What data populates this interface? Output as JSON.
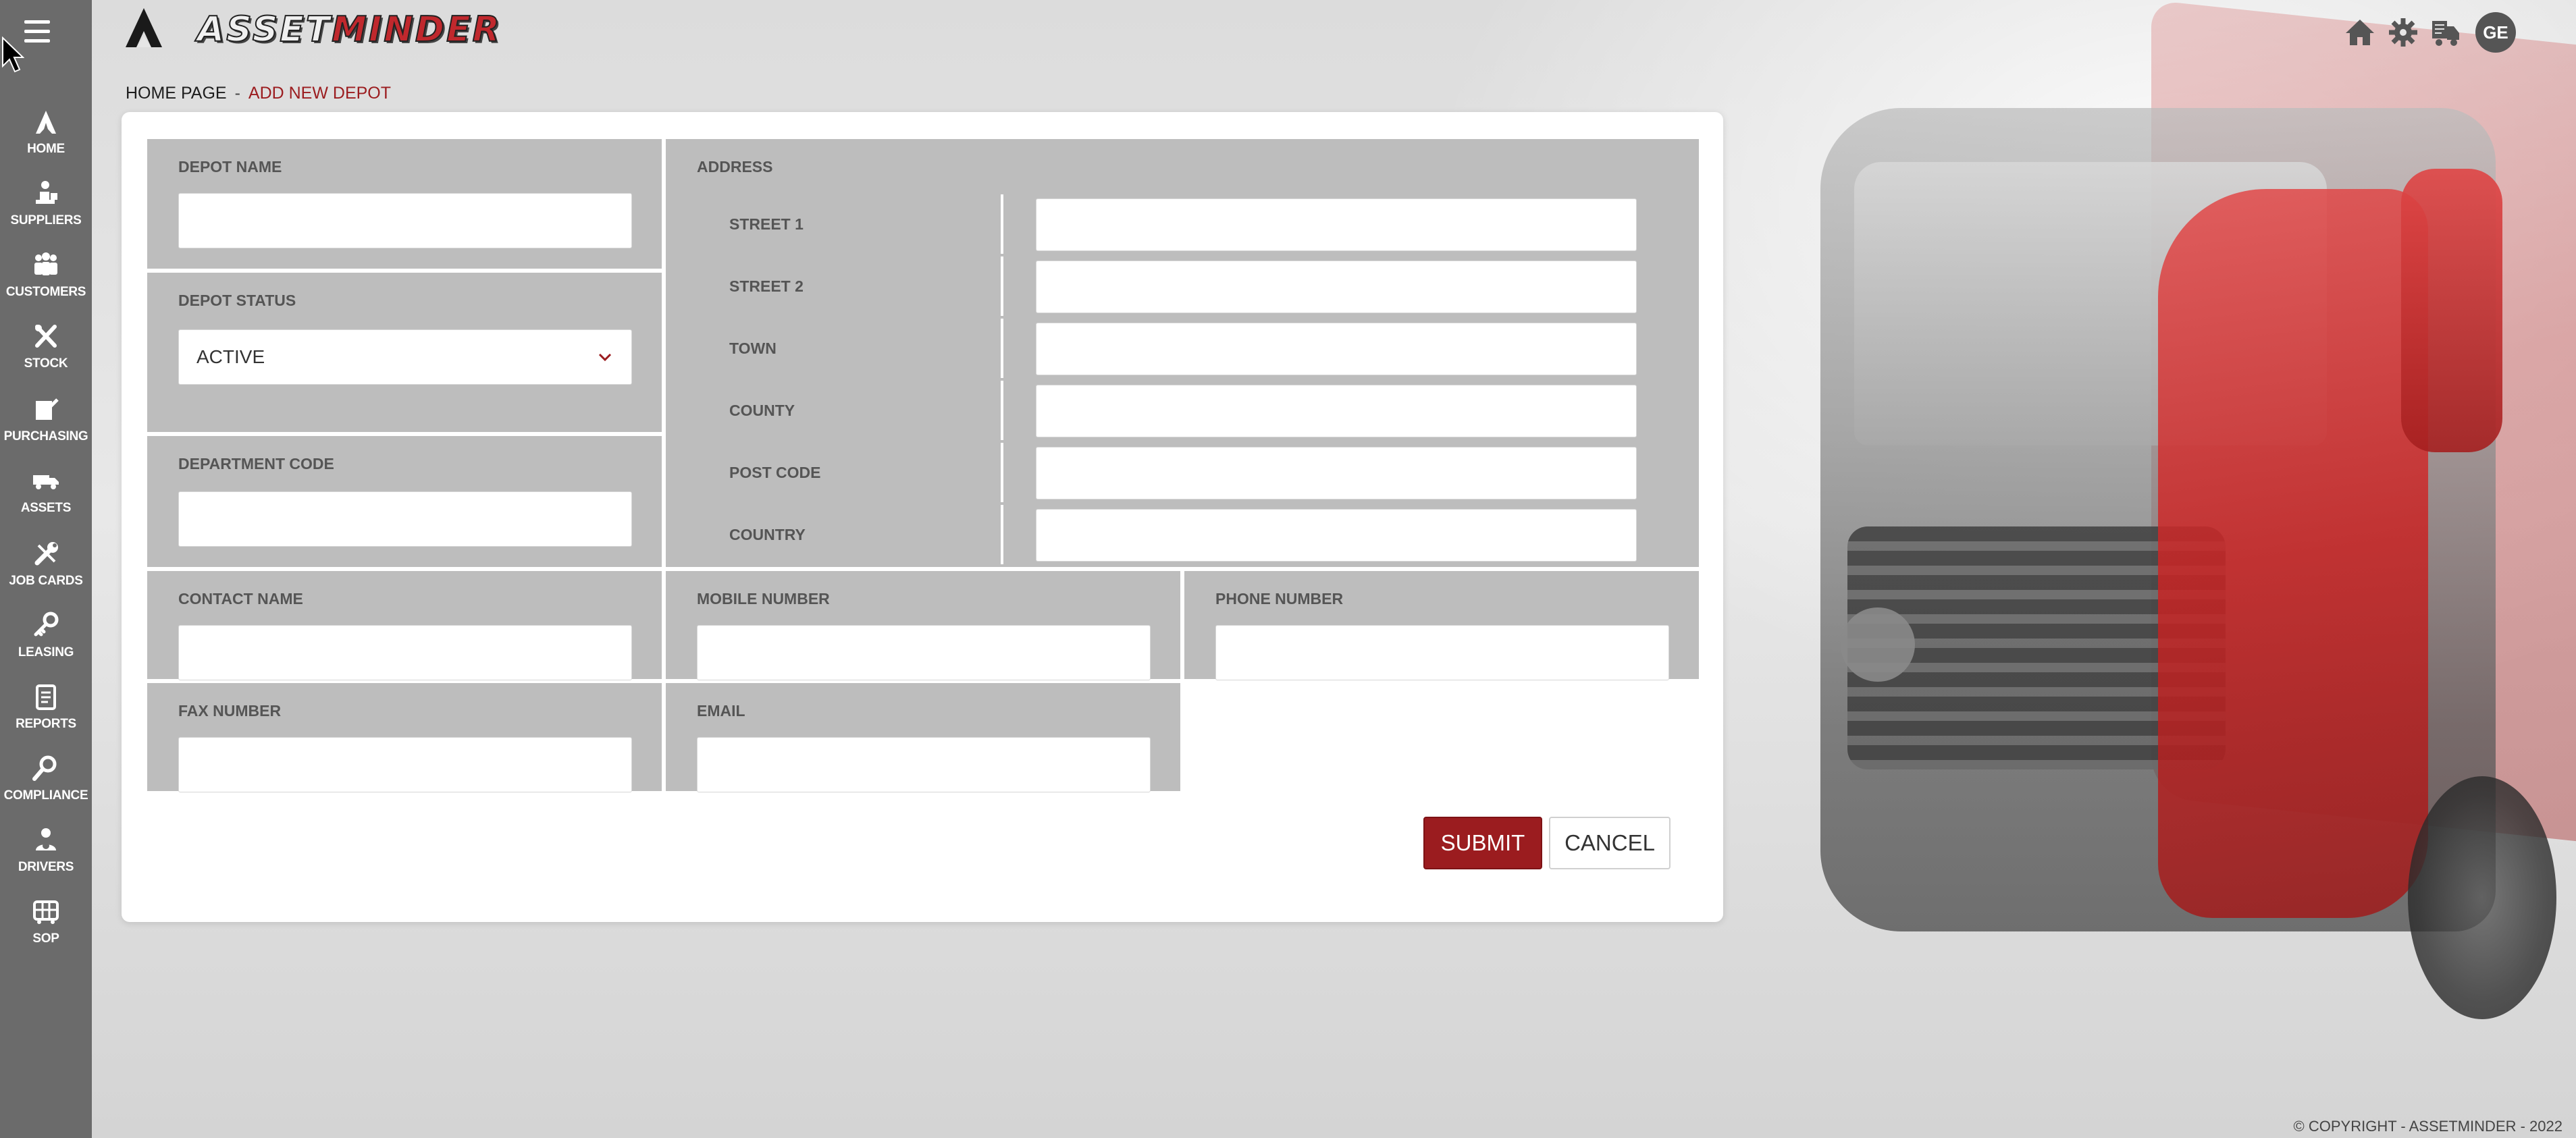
{
  "brand": {
    "name_part1": "ASSET",
    "name_part2": "MINDER"
  },
  "header": {
    "avatar_initials": "GE"
  },
  "sidebar": {
    "items": [
      {
        "label": "HOME",
        "icon": "home-icon"
      },
      {
        "label": "SUPPLIERS",
        "icon": "suppliers-icon"
      },
      {
        "label": "CUSTOMERS",
        "icon": "customers-icon"
      },
      {
        "label": "STOCK",
        "icon": "stock-icon"
      },
      {
        "label": "PURCHASING",
        "icon": "purchasing-icon"
      },
      {
        "label": "ASSETS",
        "icon": "truck-icon"
      },
      {
        "label": "JOB CARDS",
        "icon": "wrench-icon"
      },
      {
        "label": "LEASING",
        "icon": "key-icon"
      },
      {
        "label": "REPORTS",
        "icon": "clipboard-icon"
      },
      {
        "label": "COMPLIANCE",
        "icon": "compliance-icon"
      },
      {
        "label": "DRIVERS",
        "icon": "driver-icon"
      },
      {
        "label": "SOP",
        "icon": "sop-icon"
      }
    ]
  },
  "breadcrumb": {
    "home": "HOME PAGE",
    "separator": "-",
    "current": "ADD NEW DEPOT"
  },
  "form": {
    "depot_name": {
      "label": "DEPOT NAME",
      "value": ""
    },
    "depot_status": {
      "label": "DEPOT STATUS",
      "value": "ACTIVE"
    },
    "department_code": {
      "label": "DEPARTMENT CODE",
      "value": ""
    },
    "address": {
      "label": "ADDRESS",
      "rows": [
        {
          "label": "STREET 1",
          "value": ""
        },
        {
          "label": "STREET 2",
          "value": ""
        },
        {
          "label": "TOWN",
          "value": ""
        },
        {
          "label": "COUNTY",
          "value": ""
        },
        {
          "label": "POST CODE",
          "value": ""
        },
        {
          "label": "COUNTRY",
          "value": ""
        }
      ]
    },
    "contact_name": {
      "label": "CONTACT NAME",
      "value": ""
    },
    "mobile_number": {
      "label": "MOBILE NUMBER",
      "value": ""
    },
    "phone_number": {
      "label": "PHONE NUMBER",
      "value": ""
    },
    "fax_number": {
      "label": "FAX NUMBER",
      "value": ""
    },
    "email": {
      "label": "EMAIL",
      "value": ""
    },
    "submit_label": "SUBMIT",
    "cancel_label": "CANCEL"
  },
  "footer": {
    "copyright": "© COPYRIGHT - ASSETMINDER - 2022"
  },
  "colors": {
    "accent": "#9b1c1f",
    "sidebar": "#6b6b6b",
    "field_bg": "#bdbdbd"
  }
}
